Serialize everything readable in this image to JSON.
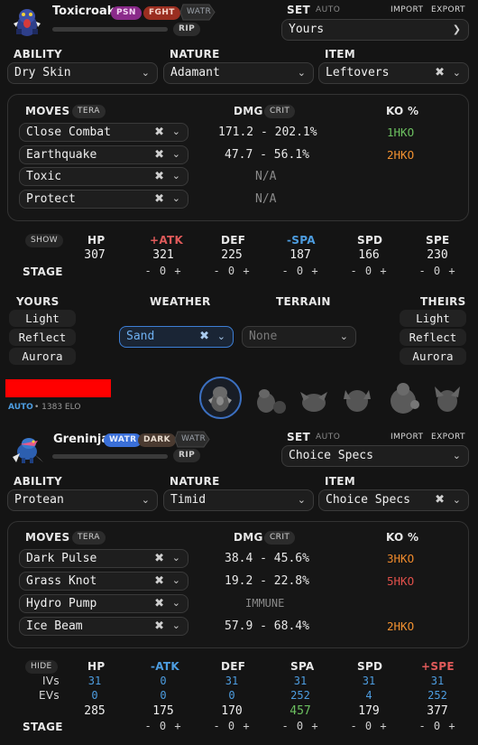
{
  "attacker": {
    "name": "Toxicroak",
    "types": [
      "PSN",
      "FGHT"
    ],
    "tera_type": "WATR",
    "hp_status": "RIP",
    "set_label": "SET",
    "set_auto": "AUTO",
    "import_label": "IMPORT",
    "export_label": "EXPORT",
    "set_value": "Yours",
    "ability_label": "ABILITY",
    "ability": "Dry Skin",
    "nature_label": "NATURE",
    "nature": "Adamant",
    "item_label": "ITEM",
    "item": "Leftovers",
    "moves_label": "MOVES",
    "tera_label": "TERA",
    "dmg_label": "DMG",
    "crit_label": "CRIT",
    "ko_label": "KO %",
    "moves": [
      {
        "name": "Close Combat",
        "dmg": "171.2 - 202.1%",
        "ko": "1HKO"
      },
      {
        "name": "Earthquake",
        "dmg": "47.7 - 56.1%",
        "ko": "2HKO"
      },
      {
        "name": "Toxic",
        "dmg": "N/A",
        "ko": ""
      },
      {
        "name": "Protect",
        "dmg": "N/A",
        "ko": ""
      }
    ],
    "stats": {
      "toggle": "SHOW",
      "headers": [
        "HP",
        "+ATK",
        "DEF",
        "-SPA",
        "SPD",
        "SPE"
      ],
      "values": [
        "307",
        "321",
        "225",
        "187",
        "166",
        "230"
      ],
      "stage_label": "STAGE",
      "stage": "- 0 +"
    }
  },
  "field": {
    "yours_label": "YOURS",
    "theirs_label": "THEIRS",
    "weather_label": "WEATHER",
    "terrain_label": "TERRAIN",
    "yours_buttons": [
      "Light",
      "Reflect",
      "Aurora"
    ],
    "theirs_buttons": [
      "Light",
      "Reflect",
      "Aurora"
    ],
    "weather": "Sand",
    "terrain_placeholder": "None"
  },
  "team_bar": {
    "mode": "AUTO",
    "elo": "• 1383 ELO",
    "accent_color": "#ff0000"
  },
  "defender": {
    "name": "Greninja",
    "types": [
      "WATR",
      "DARK"
    ],
    "tera_type": "WATR",
    "hp_status": "RIP",
    "set_label": "SET",
    "set_auto": "AUTO",
    "import_label": "IMPORT",
    "export_label": "EXPORT",
    "set_value": "Choice Specs",
    "ability_label": "ABILITY",
    "ability": "Protean",
    "nature_label": "NATURE",
    "nature": "Timid",
    "item_label": "ITEM",
    "item": "Choice Specs",
    "moves_label": "MOVES",
    "tera_label": "TERA",
    "dmg_label": "DMG",
    "crit_label": "CRIT",
    "ko_label": "KO %",
    "moves": [
      {
        "name": "Dark Pulse",
        "dmg": "38.4 - 45.6%",
        "ko": "3HKO"
      },
      {
        "name": "Grass Knot",
        "dmg": "19.2 - 22.8%",
        "ko": "5HKO"
      },
      {
        "name": "Hydro Pump",
        "dmg": "IMMUNE",
        "ko": ""
      },
      {
        "name": "Ice Beam",
        "dmg": "57.9 - 68.4%",
        "ko": "2HKO"
      }
    ],
    "stats": {
      "toggle": "HIDE",
      "headers": [
        "HP",
        "-ATK",
        "DEF",
        "SPA",
        "SPD",
        "+SPE"
      ],
      "ivs_label": "IVs",
      "evs_label": "EVs",
      "ivs": [
        "31",
        "0",
        "31",
        "31",
        "31",
        "31"
      ],
      "evs": [
        "0",
        "0",
        "0",
        "252",
        "4",
        "252"
      ],
      "values": [
        "285",
        "175",
        "170",
        "457",
        "179",
        "377"
      ],
      "stage_label": "STAGE",
      "stage": "- 0 +"
    }
  },
  "colors": {
    "psn": "#8a2a8a",
    "fght": "#9a2e20",
    "watr": "#3a6fd8",
    "dark": "#4a3a30",
    "tera_tag": "#3a3a3a"
  }
}
